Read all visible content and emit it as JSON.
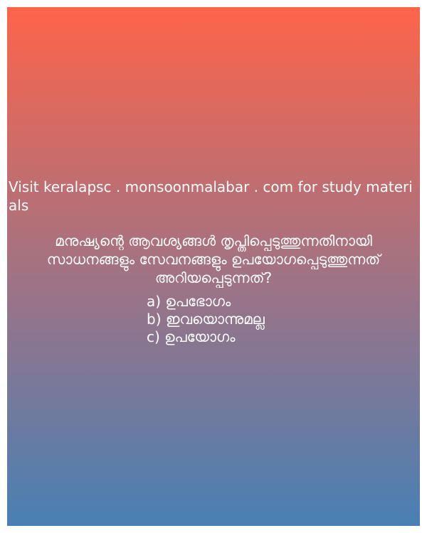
{
  "promo_text": "Visit keralapsc . monsoonmalabar . com for study materials",
  "question": {
    "text": "മനുഷ്യന്റെ ആവശ്യങ്ങൾ തൃപ്തിപ്പെടുത്തുന്നതിനായി സാധനങ്ങളും സേവനങ്ങളും ഉപയോഗപ്പെടുത്തുന്നത് അറിയപ്പെടുന്നത്?",
    "options": [
      "a) ഉപഭോഗം",
      "b) ഇവയൊന്നുമല്ല",
      "c) ഉപയോഗം"
    ]
  },
  "colors": {
    "gradient_top": "#fe644a",
    "gradient_bottom": "#4880b4",
    "text": "#ffffff"
  }
}
